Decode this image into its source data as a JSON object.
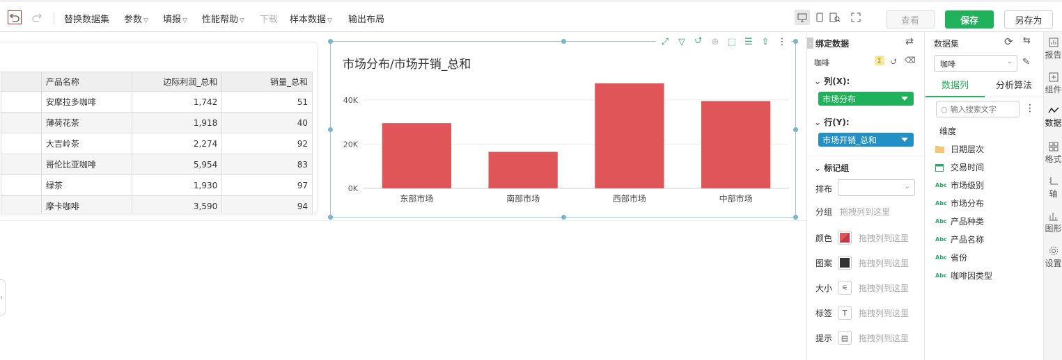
{
  "toolbar": {
    "items": [
      "替换数据集",
      "参数",
      "填报",
      "性能帮助",
      "下载",
      "样本数据",
      "输出布局"
    ],
    "view_button": "查看",
    "save_button": "保存",
    "save_as_button": "另存为"
  },
  "table": {
    "headers": [
      "",
      "产品名称",
      "边际利润_总和",
      "销量_总和"
    ],
    "rows": [
      [
        "",
        "安摩拉多咖啡",
        "1,742",
        "51"
      ],
      [
        "",
        "薄荷花茶",
        "1,918",
        "40"
      ],
      [
        "",
        "大吉岭茶",
        "2,274",
        "92"
      ],
      [
        "",
        "哥伦比亚咖啡",
        "5,954",
        "83"
      ],
      [
        "",
        "绿茶",
        "1,930",
        "97"
      ],
      [
        "",
        "摩卡咖啡",
        "3,590",
        "94"
      ]
    ]
  },
  "chart_data": {
    "type": "bar",
    "title": "市场分布/市场开销_总和",
    "categories": [
      "东部市场",
      "南部市场",
      "西部市场",
      "中部市场"
    ],
    "values": [
      29500,
      16500,
      47500,
      39500
    ],
    "ylim": [
      0,
      50000
    ],
    "yticks": [
      "0K",
      "20K",
      "40K"
    ],
    "ytick_values": [
      0,
      20000,
      40000
    ],
    "color": "#e05558",
    "grid": true
  },
  "binding": {
    "title": "绑定数据",
    "dataset": "咖啡",
    "columns_label": "列(X):",
    "columns_field": "市场分布",
    "rows_label": "行(Y):",
    "rows_field": "市场开销_总和",
    "marks_label": "标记组",
    "sort_label": "排布",
    "group_label": "分组",
    "group_hint": "拖拽列到这里",
    "marks": [
      {
        "label": "颜色",
        "hint": "拖拽列到这里",
        "icon": "color-icon"
      },
      {
        "label": "图案",
        "hint": "拖拽列到这里",
        "icon": "pattern-icon"
      },
      {
        "label": "大小",
        "hint": "拖拽列到这里",
        "icon": "size-icon"
      },
      {
        "label": "标签",
        "hint": "拖拽列到这里",
        "icon": "label-icon"
      },
      {
        "label": "提示",
        "hint": "拖拽列到这里",
        "icon": "tooltip-icon"
      }
    ]
  },
  "dataset_panel": {
    "title": "数据集",
    "selected": "咖啡",
    "tab_columns": "数据列",
    "tab_algo": "分析算法",
    "search_placeholder": "输入搜索文字",
    "dimension_label": "维度",
    "fields": [
      {
        "name": "日期层次",
        "icon": "folder-icon"
      },
      {
        "name": "交易时间",
        "icon": "calendar-icon"
      },
      {
        "name": "市场级别",
        "icon": "text-field-icon"
      },
      {
        "name": "市场分布",
        "icon": "text-field-icon"
      },
      {
        "name": "产品种类",
        "icon": "text-field-icon"
      },
      {
        "name": "产品名称",
        "icon": "text-field-icon"
      },
      {
        "name": "省份",
        "icon": "text-field-icon"
      },
      {
        "name": "咖啡因类型",
        "icon": "text-field-icon"
      }
    ],
    "abc_glyph": "Abc"
  },
  "sidebar": [
    "报告",
    "组件",
    "数据",
    "格式",
    "轴",
    "图形",
    "设置"
  ]
}
